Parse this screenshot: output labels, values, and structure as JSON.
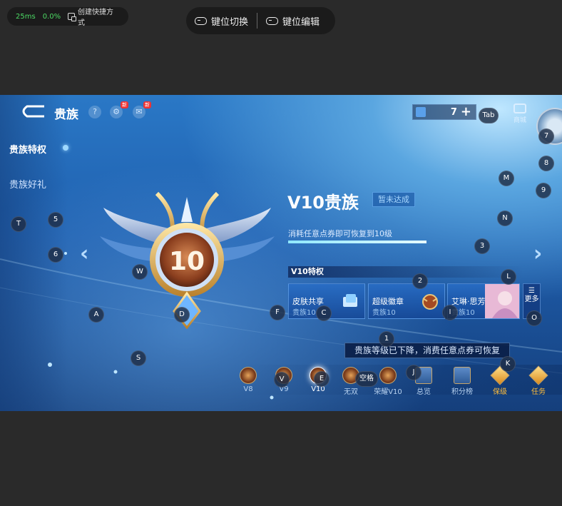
{
  "overlay": {
    "ping": "25ms",
    "loss": "0.0%",
    "shortcut_label": "创建快捷方式",
    "key_switch": "键位切换",
    "key_edit": "键位编辑"
  },
  "game": {
    "header": {
      "title": "贵族",
      "help_glyph": "?",
      "new_tag_1": "新",
      "new_tag_2": "新",
      "coupon_count": "7",
      "coupon_plus": "+",
      "shop_label": "商城"
    },
    "nav": [
      "贵族特权",
      "贵族好礼"
    ],
    "level_title": "V10贵族",
    "level_badge": "暂未达成",
    "level_number": "10",
    "level_desc": "消耗任意点券即可恢复到10级",
    "level_progress": 1.0,
    "privileges_title": "V10特权",
    "privileges": [
      {
        "name": "皮肤共享",
        "sub": "贵族10"
      },
      {
        "name": "超级徽章",
        "sub": "贵族10"
      },
      {
        "name": "艾琳·思芳踪",
        "sub": "贵族10"
      }
    ],
    "more_label": "更多",
    "tooltip": "贵族等级已下降，消费任意点券可恢复",
    "levels": [
      {
        "label": "V8"
      },
      {
        "label": "V9"
      },
      {
        "label": "V10"
      },
      {
        "label": "无双"
      },
      {
        "label": "荣耀V10"
      },
      {
        "label": "总览"
      },
      {
        "label": "积分榜"
      },
      {
        "label": "保级"
      },
      {
        "label": "任务"
      }
    ]
  },
  "key_hints": [
    "Tab",
    "7",
    "8",
    "M",
    "9",
    "T",
    "5",
    "N",
    "6",
    "3",
    "W",
    "L",
    "2",
    "A",
    "D",
    "F",
    "C",
    "I",
    "O",
    "1",
    "S",
    "E",
    "空格",
    "J",
    "K",
    "V"
  ]
}
